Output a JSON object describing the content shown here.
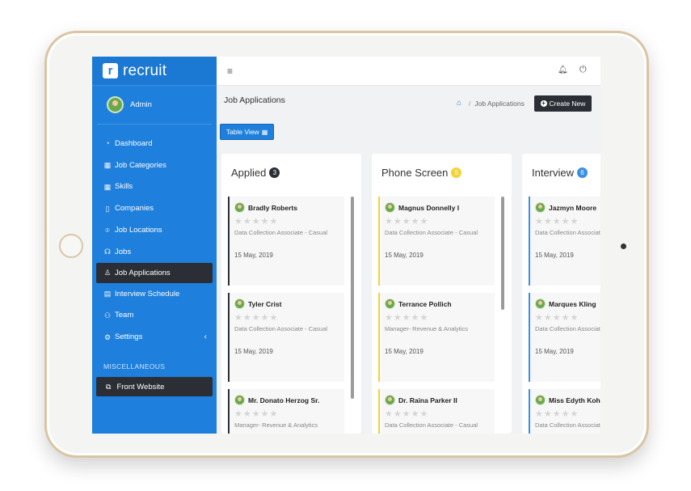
{
  "brand": {
    "logo_letter": "r",
    "name": "recruit"
  },
  "user": {
    "name": "Admin"
  },
  "sidebar": {
    "items": [
      {
        "label": "Dashboard",
        "icon": "gauge-icon"
      },
      {
        "label": "Job Categories",
        "icon": "grid-icon"
      },
      {
        "label": "Skills",
        "icon": "grid-icon"
      },
      {
        "label": "Companies",
        "icon": "building-icon"
      },
      {
        "label": "Job Locations",
        "icon": "location-pin-icon"
      },
      {
        "label": "Jobs",
        "icon": "people-icon"
      },
      {
        "label": "Job Applications",
        "icon": "user-icon",
        "active": true
      },
      {
        "label": "Interview Schedule",
        "icon": "calendar-icon"
      },
      {
        "label": "Team",
        "icon": "team-icon"
      },
      {
        "label": "Settings",
        "icon": "gear-icon",
        "has_chevron": true
      }
    ],
    "section_label": "MISCELLANEOUS",
    "front_website": "Front Website"
  },
  "topbar": {
    "menu_icon": "hamburger-icon",
    "bell_icon": "bell-icon",
    "power_icon": "power-icon"
  },
  "header": {
    "title": "Job Applications",
    "breadcrumb": {
      "current": "Job Applications"
    },
    "create_button": "Create New",
    "table_view_button": "Table View"
  },
  "columns": [
    {
      "title": "Applied",
      "count": "3",
      "badge_color": "#2b2f35",
      "accent": "#2b2f35",
      "cards": [
        {
          "name": "Bradly Roberts",
          "job": "Data Collection Associate - Casual",
          "date": "15 May, 2019"
        },
        {
          "name": "Tyler Crist",
          "job": "Data Collection Associate - Casual",
          "date": "15 May, 2019"
        },
        {
          "name": "Mr. Donato Herzog Sr.",
          "job": "Manager- Revenue & Analytics",
          "date": ""
        }
      ]
    },
    {
      "title": "Phone Screen",
      "count": "5",
      "badge_color": "#f2d33b",
      "accent": "#f2d33b",
      "cards": [
        {
          "name": "Magnus Donnelly I",
          "job": "Data Collection Associate - Casual",
          "date": "15 May, 2019"
        },
        {
          "name": "Terrance Pollich",
          "job": "Manager- Revenue & Analytics",
          "date": "15 May, 2019"
        },
        {
          "name": "Dr. Raina Parker II",
          "job": "Data Collection Associate - Casual",
          "date": ""
        }
      ]
    },
    {
      "title": "Interview",
      "count": "6",
      "badge_color": "#3b8fe6",
      "accent": "#3b8fe6",
      "cards": [
        {
          "name": "Jazmyn Moore",
          "job": "Data Collection Associate - Casual",
          "date": "15 May, 2019"
        },
        {
          "name": "Marques Kling",
          "job": "Data Collection Associate - Casual",
          "date": "15 May, 2019"
        },
        {
          "name": "Miss Edyth Kohler",
          "job": "Data Collection Associate - Casual",
          "date": ""
        }
      ]
    }
  ]
}
